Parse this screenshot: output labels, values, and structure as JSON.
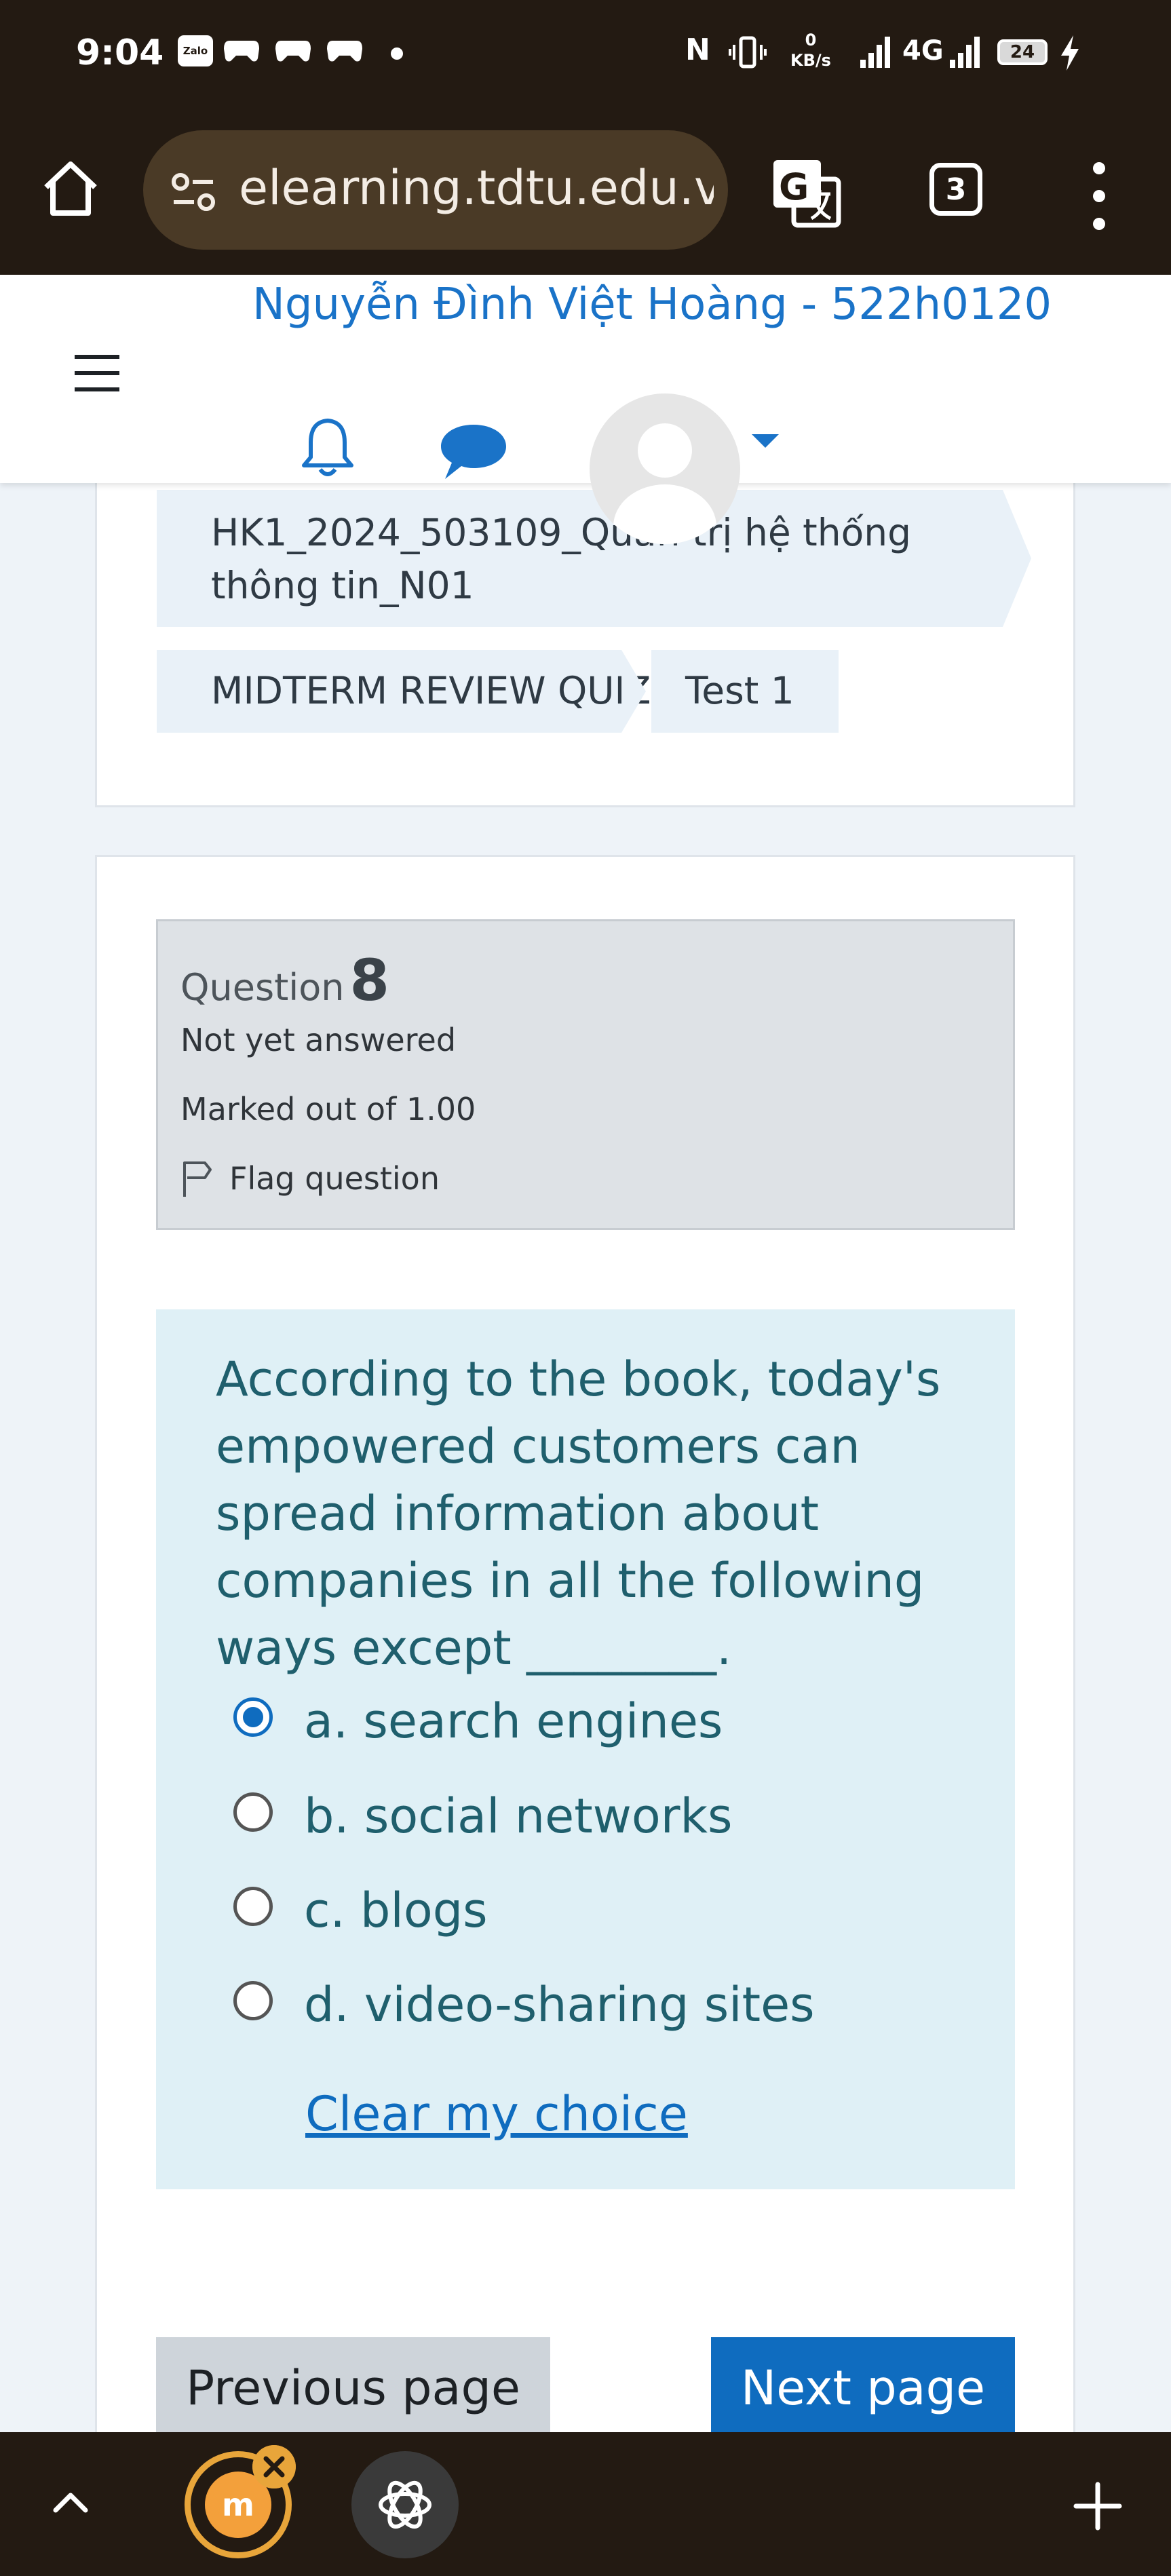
{
  "status_bar": {
    "time": "9:04",
    "app_badge": "Zalo",
    "net_speed_value": "0",
    "net_speed_unit": "KB/s",
    "network_type": "4G",
    "battery": "24"
  },
  "browser": {
    "url": "elearning.tdtu.edu.vn/",
    "tab_count": "3"
  },
  "header": {
    "user_name": "Nguyễn Đình Việt Hoàng - 522h0120"
  },
  "breadcrumb": {
    "course": "HK1_2024_503109_Quản trị hệ thống thông tin_N01",
    "quiz": "MIDTERM REVIEW QUIZ",
    "attempt": "Test 1"
  },
  "question": {
    "label": "Question",
    "number": "8",
    "state": "Not yet answered",
    "grade": "Marked out of 1.00",
    "flag_label": "Flag question",
    "text": "According to the book, today's empowered customers can spread information about companies in all the following ways except ________.",
    "options": [
      {
        "label": "a. search engines",
        "selected": true
      },
      {
        "label": "b. social networks",
        "selected": false
      },
      {
        "label": "c. blogs",
        "selected": false
      },
      {
        "label": "d. video-sharing sites",
        "selected": false
      }
    ],
    "clear_label": "Clear my choice"
  },
  "navigation": {
    "previous_label": "Previous page",
    "next_label": "Next page"
  },
  "bottom_bar": {
    "moodle_logo_text": "m"
  },
  "colors": {
    "chrome_dark": "#231a12",
    "brand_blue": "#0f6cbf",
    "question_bg": "#dff0f6",
    "info_bg": "#dee2e6"
  }
}
